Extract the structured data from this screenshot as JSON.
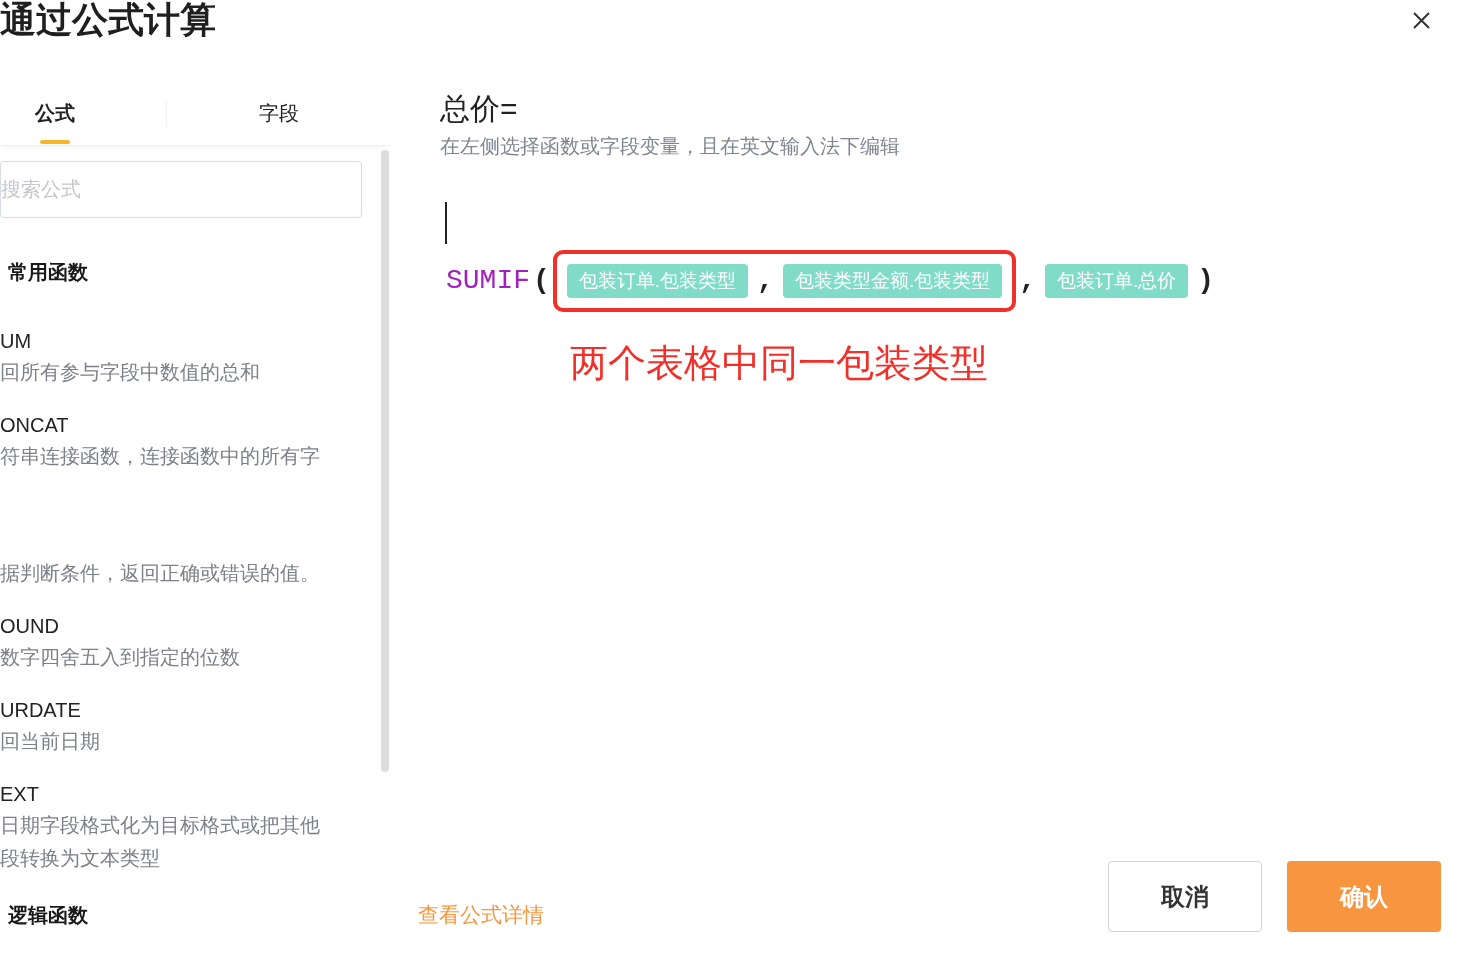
{
  "dialog_title": "通过公式计算",
  "tabs": [
    {
      "label": "公式",
      "selected": true
    },
    {
      "label": "字段",
      "selected": false
    }
  ],
  "search": {
    "placeholder": "搜索公式"
  },
  "function_groups": [
    {
      "title": "常用函数",
      "functions": [
        {
          "name": "UM",
          "description": "回所有参与字段中数值的总和"
        },
        {
          "name": "ONCAT",
          "description": "符串连接函数，连接函数中的所有字"
        },
        {
          "description": "据判断条件，返回正确或错误的值。"
        },
        {
          "name": "OUND",
          "description": "数字四舍五入到指定的位数"
        },
        {
          "name": "URDATE",
          "description": "回当前日期"
        },
        {
          "name": "EXT",
          "description": "日期字段格式化为目标格式或把其他段转换为文本类型"
        }
      ]
    },
    {
      "title": "逻辑函数"
    }
  ],
  "formula": {
    "label": "总价=",
    "hint": "在左侧选择函数或字段变量，且在英文输入法下编辑",
    "tokens": [
      {
        "kind": "function",
        "text": "SUMIF",
        "highlighted": false
      },
      {
        "kind": "punct",
        "text": "(",
        "highlighted": false
      },
      {
        "kind": "field",
        "text": "包装订单.包装类型",
        "highlighted": true
      },
      {
        "kind": "punct",
        "text": ",",
        "highlighted": true
      },
      {
        "kind": "field",
        "text": "包装类型金额.包装类型",
        "highlighted": true
      },
      {
        "kind": "punct",
        "text": ",",
        "highlighted": false
      },
      {
        "kind": "field",
        "text": "包装订单.总价",
        "highlighted": false
      },
      {
        "kind": "punct",
        "text": ")",
        "highlighted": false
      }
    ],
    "annotation": "两个表格中同一包装类型"
  },
  "details_link": "查看公式详情",
  "buttons": {
    "cancel": "取消",
    "confirm": "确认"
  }
}
